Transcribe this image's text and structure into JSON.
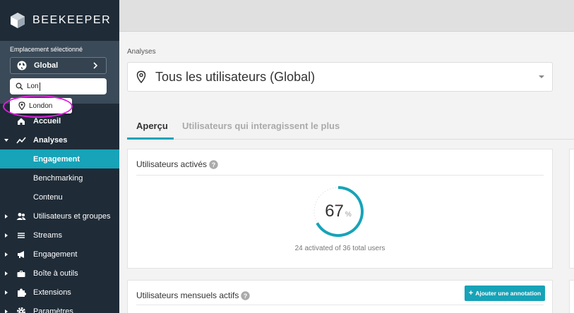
{
  "brand": {
    "name": "BEEKEEPER"
  },
  "location": {
    "label": "Emplacement sélectionné",
    "selected": "Global",
    "search_value": "Lon",
    "suggestion": "London"
  },
  "nav": {
    "accueil": "Accueil",
    "analyses": "Analyses",
    "engagement_sub": "Engagement",
    "benchmarking": "Benchmarking",
    "contenu": "Contenu",
    "users_groups": "Utilisateurs et groupes",
    "streams": "Streams",
    "engagement": "Engagement",
    "toolbox": "Boîte à outils",
    "extensions": "Extensions",
    "parametres": "Paramètres"
  },
  "main": {
    "breadcrumb": "Analyses",
    "filter": "Tous les utilisateurs (Global)",
    "tabs": [
      "Aperçu",
      "Utilisateurs qui interagissent le plus"
    ],
    "card_active": {
      "title": "Utilisateurs activés",
      "percent": 67,
      "percent_display": "67",
      "unit": "%",
      "caption": "24 activated of 36 total users"
    },
    "card_monthly": {
      "title": "Utilisateurs mensuels actifs",
      "add_button": "Ajouter une annotation"
    }
  },
  "colors": {
    "accent": "#17a3b8",
    "sidebar": "#1f2b37",
    "highlight": "#e21ee0"
  }
}
